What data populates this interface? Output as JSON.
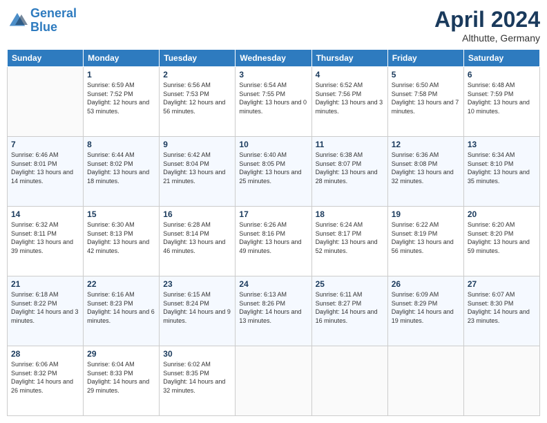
{
  "logo": {
    "line1": "General",
    "line2": "Blue"
  },
  "title": "April 2024",
  "subtitle": "Althutte, Germany",
  "days_of_week": [
    "Sunday",
    "Monday",
    "Tuesday",
    "Wednesday",
    "Thursday",
    "Friday",
    "Saturday"
  ],
  "weeks": [
    [
      {
        "day": "",
        "empty": true
      },
      {
        "day": "1",
        "sunrise": "6:59 AM",
        "sunset": "7:52 PM",
        "daylight": "12 hours and 53 minutes."
      },
      {
        "day": "2",
        "sunrise": "6:56 AM",
        "sunset": "7:53 PM",
        "daylight": "12 hours and 56 minutes."
      },
      {
        "day": "3",
        "sunrise": "6:54 AM",
        "sunset": "7:55 PM",
        "daylight": "13 hours and 0 minutes."
      },
      {
        "day": "4",
        "sunrise": "6:52 AM",
        "sunset": "7:56 PM",
        "daylight": "13 hours and 3 minutes."
      },
      {
        "day": "5",
        "sunrise": "6:50 AM",
        "sunset": "7:58 PM",
        "daylight": "13 hours and 7 minutes."
      },
      {
        "day": "6",
        "sunrise": "6:48 AM",
        "sunset": "7:59 PM",
        "daylight": "13 hours and 10 minutes."
      }
    ],
    [
      {
        "day": "7",
        "sunrise": "6:46 AM",
        "sunset": "8:01 PM",
        "daylight": "13 hours and 14 minutes."
      },
      {
        "day": "8",
        "sunrise": "6:44 AM",
        "sunset": "8:02 PM",
        "daylight": "13 hours and 18 minutes."
      },
      {
        "day": "9",
        "sunrise": "6:42 AM",
        "sunset": "8:04 PM",
        "daylight": "13 hours and 21 minutes."
      },
      {
        "day": "10",
        "sunrise": "6:40 AM",
        "sunset": "8:05 PM",
        "daylight": "13 hours and 25 minutes."
      },
      {
        "day": "11",
        "sunrise": "6:38 AM",
        "sunset": "8:07 PM",
        "daylight": "13 hours and 28 minutes."
      },
      {
        "day": "12",
        "sunrise": "6:36 AM",
        "sunset": "8:08 PM",
        "daylight": "13 hours and 32 minutes."
      },
      {
        "day": "13",
        "sunrise": "6:34 AM",
        "sunset": "8:10 PM",
        "daylight": "13 hours and 35 minutes."
      }
    ],
    [
      {
        "day": "14",
        "sunrise": "6:32 AM",
        "sunset": "8:11 PM",
        "daylight": "13 hours and 39 minutes."
      },
      {
        "day": "15",
        "sunrise": "6:30 AM",
        "sunset": "8:13 PM",
        "daylight": "13 hours and 42 minutes."
      },
      {
        "day": "16",
        "sunrise": "6:28 AM",
        "sunset": "8:14 PM",
        "daylight": "13 hours and 46 minutes."
      },
      {
        "day": "17",
        "sunrise": "6:26 AM",
        "sunset": "8:16 PM",
        "daylight": "13 hours and 49 minutes."
      },
      {
        "day": "18",
        "sunrise": "6:24 AM",
        "sunset": "8:17 PM",
        "daylight": "13 hours and 52 minutes."
      },
      {
        "day": "19",
        "sunrise": "6:22 AM",
        "sunset": "8:19 PM",
        "daylight": "13 hours and 56 minutes."
      },
      {
        "day": "20",
        "sunrise": "6:20 AM",
        "sunset": "8:20 PM",
        "daylight": "13 hours and 59 minutes."
      }
    ],
    [
      {
        "day": "21",
        "sunrise": "6:18 AM",
        "sunset": "8:22 PM",
        "daylight": "14 hours and 3 minutes."
      },
      {
        "day": "22",
        "sunrise": "6:16 AM",
        "sunset": "8:23 PM",
        "daylight": "14 hours and 6 minutes."
      },
      {
        "day": "23",
        "sunrise": "6:15 AM",
        "sunset": "8:24 PM",
        "daylight": "14 hours and 9 minutes."
      },
      {
        "day": "24",
        "sunrise": "6:13 AM",
        "sunset": "8:26 PM",
        "daylight": "14 hours and 13 minutes."
      },
      {
        "day": "25",
        "sunrise": "6:11 AM",
        "sunset": "8:27 PM",
        "daylight": "14 hours and 16 minutes."
      },
      {
        "day": "26",
        "sunrise": "6:09 AM",
        "sunset": "8:29 PM",
        "daylight": "14 hours and 19 minutes."
      },
      {
        "day": "27",
        "sunrise": "6:07 AM",
        "sunset": "8:30 PM",
        "daylight": "14 hours and 23 minutes."
      }
    ],
    [
      {
        "day": "28",
        "sunrise": "6:06 AM",
        "sunset": "8:32 PM",
        "daylight": "14 hours and 26 minutes."
      },
      {
        "day": "29",
        "sunrise": "6:04 AM",
        "sunset": "8:33 PM",
        "daylight": "14 hours and 29 minutes."
      },
      {
        "day": "30",
        "sunrise": "6:02 AM",
        "sunset": "8:35 PM",
        "daylight": "14 hours and 32 minutes."
      },
      {
        "day": "",
        "empty": true
      },
      {
        "day": "",
        "empty": true
      },
      {
        "day": "",
        "empty": true
      },
      {
        "day": "",
        "empty": true
      }
    ]
  ]
}
